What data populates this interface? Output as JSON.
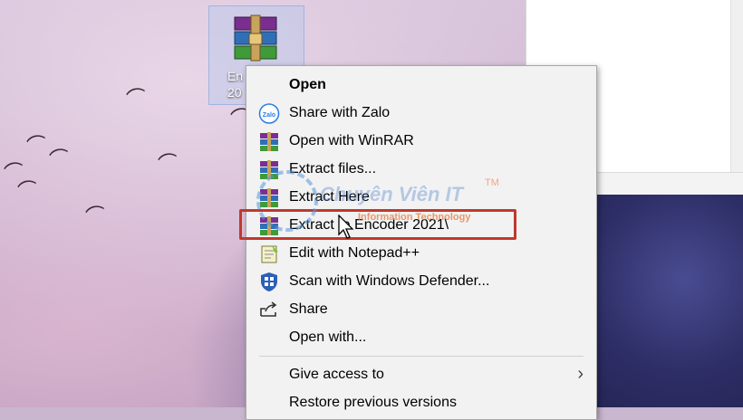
{
  "desktop": {
    "icon_label_line1": "En",
    "icon_label_line2": "20"
  },
  "context_menu": {
    "items": [
      {
        "label": "Open",
        "icon": "none",
        "bold": true
      },
      {
        "label": "Share with Zalo",
        "icon": "zalo-icon"
      },
      {
        "label": "Open with WinRAR",
        "icon": "winrar-icon"
      },
      {
        "label": "Extract files...",
        "icon": "winrar-icon"
      },
      {
        "label": "Extract Here",
        "icon": "winrar-icon"
      },
      {
        "label": "Extract to Encoder 2021\\",
        "icon": "winrar-icon"
      },
      {
        "label": "Edit with Notepad++",
        "icon": "notepad-plus-plus-icon"
      },
      {
        "label": "Scan with Windows Defender...",
        "icon": "windows-defender-icon"
      },
      {
        "label": "Share",
        "icon": "share-icon"
      },
      {
        "label": "Open with...",
        "icon": "none"
      },
      {
        "label": "Give access to",
        "icon": "none",
        "submenu": true
      },
      {
        "label": "Restore previous versions",
        "icon": "none"
      }
    ],
    "highlighted_item": "Extract to Encoder 2021\\"
  },
  "watermark": {
    "title": "Chuyên Viên IT",
    "tm": "TM",
    "subtitle": "Information Technology"
  },
  "colors": {
    "highlight_border": "#c0392b",
    "menu_bg": "#f2f2f2",
    "accent_orange": "#e7722e"
  }
}
